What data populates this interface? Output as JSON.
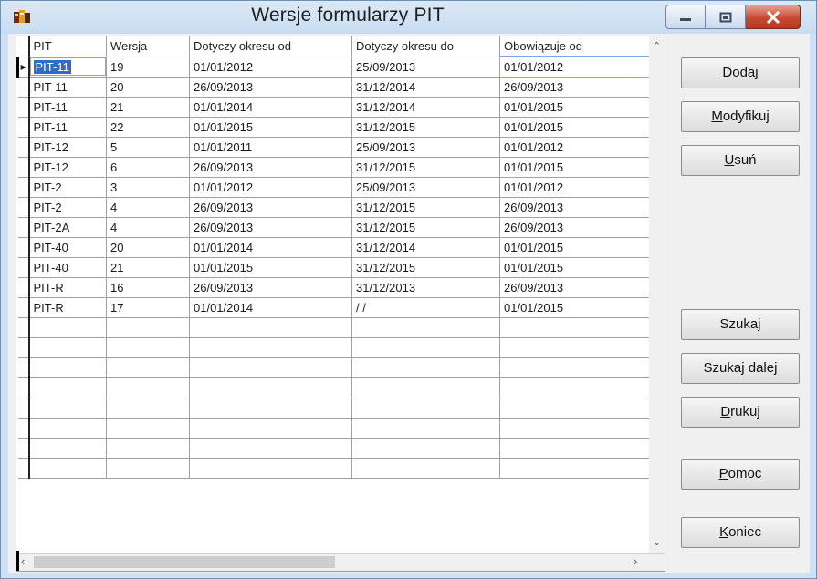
{
  "window": {
    "title_part1": "Wersje formularzy",
    "title_part2": "PIT"
  },
  "grid": {
    "columns": [
      "PIT",
      "Wersja",
      "Dotyczy okresu od",
      "Dotyczy okresu do",
      "Obowiązuje od"
    ],
    "rows": [
      [
        "PIT-11",
        "19",
        "01/01/2012",
        "25/09/2013",
        "01/01/2012"
      ],
      [
        "PIT-11",
        "20",
        "26/09/2013",
        "31/12/2014",
        "26/09/2013"
      ],
      [
        "PIT-11",
        "21",
        "01/01/2014",
        "31/12/2014",
        "01/01/2015"
      ],
      [
        "PIT-11",
        "22",
        "01/01/2015",
        "31/12/2015",
        "01/01/2015"
      ],
      [
        "PIT-12",
        "5",
        "01/01/2011",
        "25/09/2013",
        "01/01/2012"
      ],
      [
        "PIT-12",
        "6",
        "26/09/2013",
        "31/12/2015",
        "01/01/2015"
      ],
      [
        "PIT-2",
        "3",
        "01/01/2012",
        "25/09/2013",
        "01/01/2012"
      ],
      [
        "PIT-2",
        "4",
        "26/09/2013",
        "31/12/2015",
        "26/09/2013"
      ],
      [
        "PIT-2A",
        "4",
        "26/09/2013",
        "31/12/2015",
        "26/09/2013"
      ],
      [
        "PIT-40",
        "20",
        "01/01/2014",
        "31/12/2014",
        "01/01/2015"
      ],
      [
        "PIT-40",
        "21",
        "01/01/2015",
        "31/12/2015",
        "01/01/2015"
      ],
      [
        "PIT-R",
        "16",
        "26/09/2013",
        "31/12/2013",
        "26/09/2013"
      ],
      [
        "PIT-R",
        "17",
        "01/01/2014",
        "/ /",
        "01/01/2015"
      ]
    ],
    "empty_rows": 8,
    "selected_row": 0
  },
  "buttons": {
    "dodaj": {
      "accel": "D",
      "rest": "odaj"
    },
    "modyfikuj": {
      "accel": "M",
      "rest": "odyfikuj"
    },
    "usun": {
      "accel": "U",
      "rest": "suń"
    },
    "szukaj": "Szukaj",
    "szukaj_dalej": "Szukaj dalej",
    "drukuj": {
      "accel": "D",
      "rest": "rukuj"
    },
    "pomoc": {
      "accel": "P",
      "rest": "omoc"
    },
    "koniec": {
      "accel": "K",
      "rest": "oniec"
    }
  },
  "colors": {
    "titlebar": "#cfe1f3",
    "selection": "#2f6ec7",
    "close_button": "#c74a32"
  },
  "icons": [
    "app-icon",
    "minimize-icon",
    "maximize-icon",
    "close-icon",
    "row-pointer-icon",
    "scroll-up-icon",
    "scroll-down-icon",
    "scroll-left-icon",
    "scroll-right-icon"
  ]
}
